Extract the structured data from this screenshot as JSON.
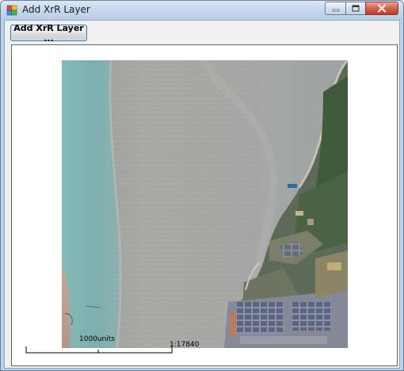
{
  "window": {
    "title": "Add XrR Layer"
  },
  "toolbar": {
    "add_layer_label": "Add XrR Layer ..."
  },
  "map": {
    "scale_units_label": "1000units",
    "scale_ratio_label": "1:17840"
  },
  "colors": {
    "titlebar": "#c3d6ec",
    "close_button": "#c23d27",
    "button_border": "#3c7fb1",
    "water": "#7fb1ad",
    "tidal_flat": "#a3a3a3",
    "forest": "#3f5a3a"
  },
  "icons": {
    "app": "app-icon",
    "minimize": "minimize-icon",
    "maximize": "maximize-icon",
    "close": "close-icon"
  }
}
